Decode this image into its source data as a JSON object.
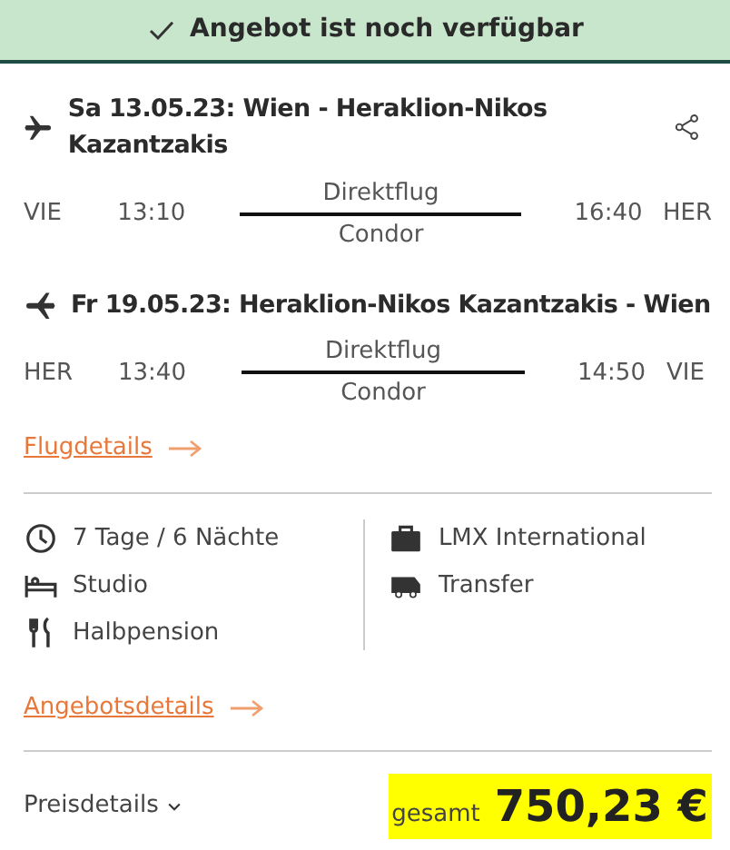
{
  "banner": {
    "text": "Angebot ist noch verfügbar"
  },
  "flights": [
    {
      "title": "Sa 13.05.23: Wien - Heraklion-Nikos Kazantzakis",
      "from_code": "VIE",
      "departure": "13:10",
      "type": "Direktflug",
      "airline": "Condor",
      "arrival": "16:40",
      "to_code": "HER"
    },
    {
      "title": "Fr 19.05.23: Heraklion-Nikos Kazantzakis - Wien",
      "from_code": "HER",
      "departure": "13:40",
      "type": "Direktflug",
      "airline": "Condor",
      "arrival": "14:50",
      "to_code": "VIE"
    }
  ],
  "flight_details_link": "Flugdetails",
  "features_left": [
    "7 Tage / 6 Nächte",
    "Studio",
    "Halbpension"
  ],
  "features_right": [
    "LMX International",
    "Transfer"
  ],
  "offer_details_link": "Angebotsdetails",
  "price": {
    "details_label": "Preisdetails",
    "total_label": "gesamt",
    "amount": "750,23 €"
  }
}
